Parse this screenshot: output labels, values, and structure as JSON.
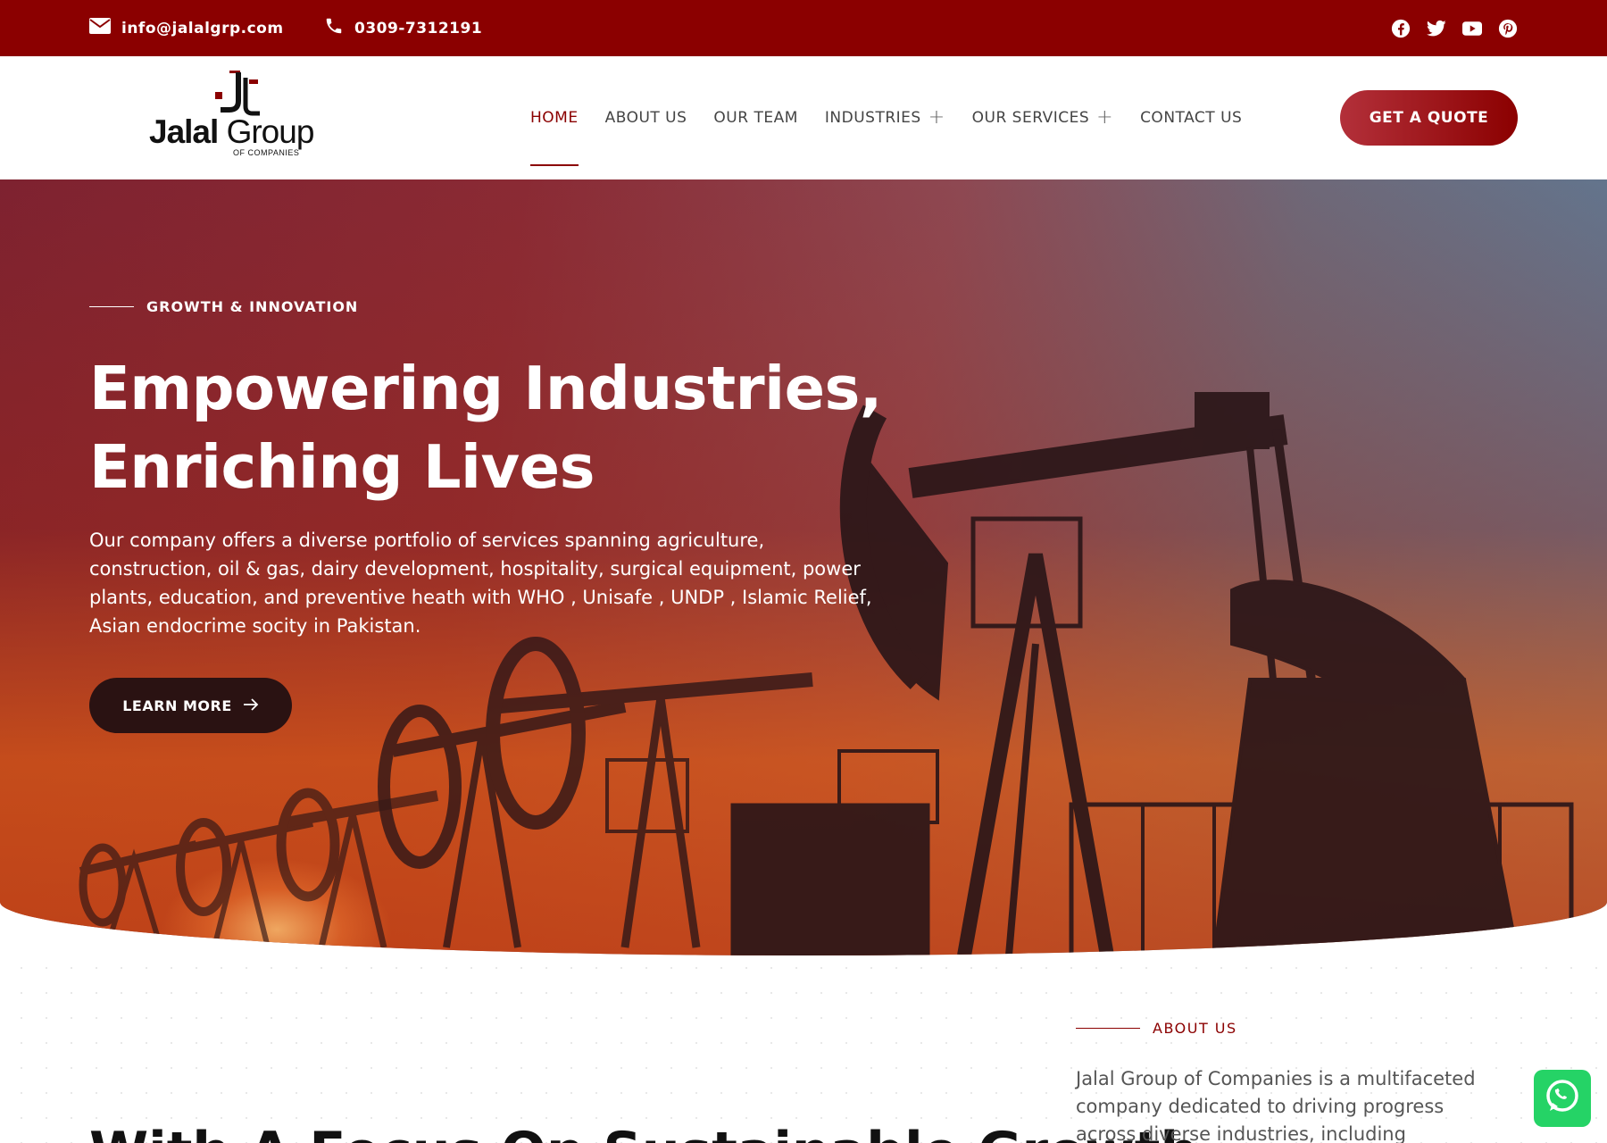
{
  "topbar": {
    "email": "info@jalalgrp.com",
    "phone": "0309-7312191",
    "socials": [
      "facebook-icon",
      "twitter-icon",
      "youtube-icon",
      "pinterest-icon"
    ]
  },
  "header": {
    "logo_brand_bold": "Jalal",
    "logo_brand_light": " Group",
    "logo_sub": "OF COMPANIES",
    "nav": [
      {
        "label": "HOME",
        "active": true
      },
      {
        "label": "ABOUT US"
      },
      {
        "label": "OUR TEAM"
      },
      {
        "label": "INDUSTRIES",
        "has_submenu": true
      },
      {
        "label": "OUR SERVICES",
        "has_submenu": true
      },
      {
        "label": "CONTACT US"
      }
    ],
    "cta": "GET A QUOTE"
  },
  "hero": {
    "eyebrow": "GROWTH & INNOVATION",
    "title_line1": "Empowering Industries,",
    "title_line2": "Enriching Lives",
    "description": "Our company offers a diverse portfolio of services spanning agriculture, construction, oil & gas, dairy development, hospitality, surgical equipment, power plants, education, and preventive heath with WHO , Unisafe , UNDP , Islamic Relief, Asian endocrime socity in Pakistan.",
    "button": "LEARN MORE"
  },
  "about": {
    "eyebrow": "ABOUT US",
    "heading": "With A Focus On Sustainable Growth",
    "text": "Jalal Group of Companies is a multifaceted company dedicated to driving progress across diverse industries, including agriculture,"
  },
  "colors": {
    "brand": "#8b0000",
    "cta_gradient_start": "#b3303a",
    "dark_button": "#2a1212",
    "whatsapp": "#25d366"
  }
}
